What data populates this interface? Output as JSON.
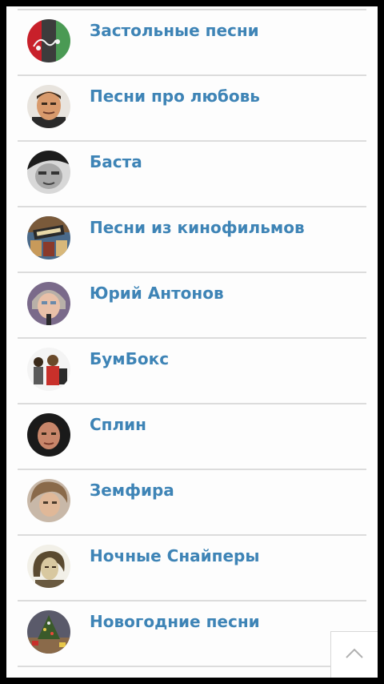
{
  "list": {
    "items": [
      {
        "title": "Застольные песни",
        "icon": "table-songs-avatar-icon"
      },
      {
        "title": "Песни про любовь",
        "icon": "man-portrait-avatar-icon"
      },
      {
        "title": "Баста",
        "icon": "basta-portrait-avatar-icon"
      },
      {
        "title": "Песни из кинофильмов",
        "icon": "film-poster-avatar-icon"
      },
      {
        "title": "Юрий Антонов",
        "icon": "singer-portrait-avatar-icon"
      },
      {
        "title": "БумБокс",
        "icon": "band-photo-avatar-icon"
      },
      {
        "title": "Сплин",
        "icon": "young-man-portrait-avatar-icon"
      },
      {
        "title": "Земфира",
        "icon": "woman-portrait-avatar-icon"
      },
      {
        "title": "Ночные Снайперы",
        "icon": "woman-sketch-avatar-icon"
      },
      {
        "title": "Новогодние песни",
        "icon": "christmas-tree-avatar-icon"
      }
    ]
  },
  "scroll_top": {
    "icon": "chevron-up-icon"
  },
  "colors": {
    "link": "#3e84b6",
    "divider": "#dcdcdc",
    "background": "#fdfdfd",
    "frame": "#000000"
  }
}
